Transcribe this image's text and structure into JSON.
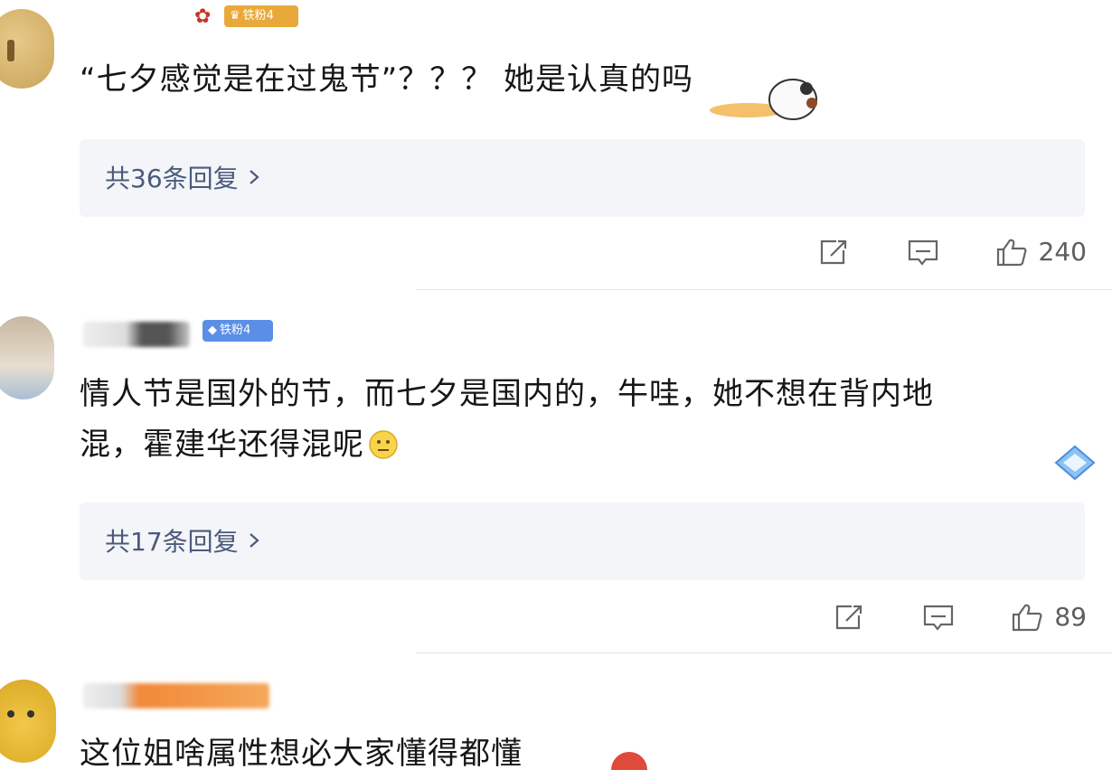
{
  "comments": [
    {
      "level_badge": "铁粉4",
      "text": "“七夕感觉是在过鬼节”？？？ 她是认真的吗",
      "reply_link": "共36条回复",
      "like_count": "240"
    },
    {
      "level_badge": "铁粉4",
      "text_line1": "情人节是国外的节，而七夕是国内的，牛哇，她不想在背内地",
      "text_line2": "混，霍建华还得混呢",
      "reply_link": "共17条回复",
      "like_count": "89"
    },
    {
      "text": "这位姐啥属性想必大家懂得都懂"
    }
  ],
  "icons": {
    "share": "share-icon",
    "comment": "comment-icon",
    "like": "thumbs-up-icon",
    "chevron": "chevron-right-icon"
  },
  "colors": {
    "reply_text": "#4b5a7c",
    "badge_blue": "#5b8fe6",
    "badge_gold": "#e9a93a"
  }
}
